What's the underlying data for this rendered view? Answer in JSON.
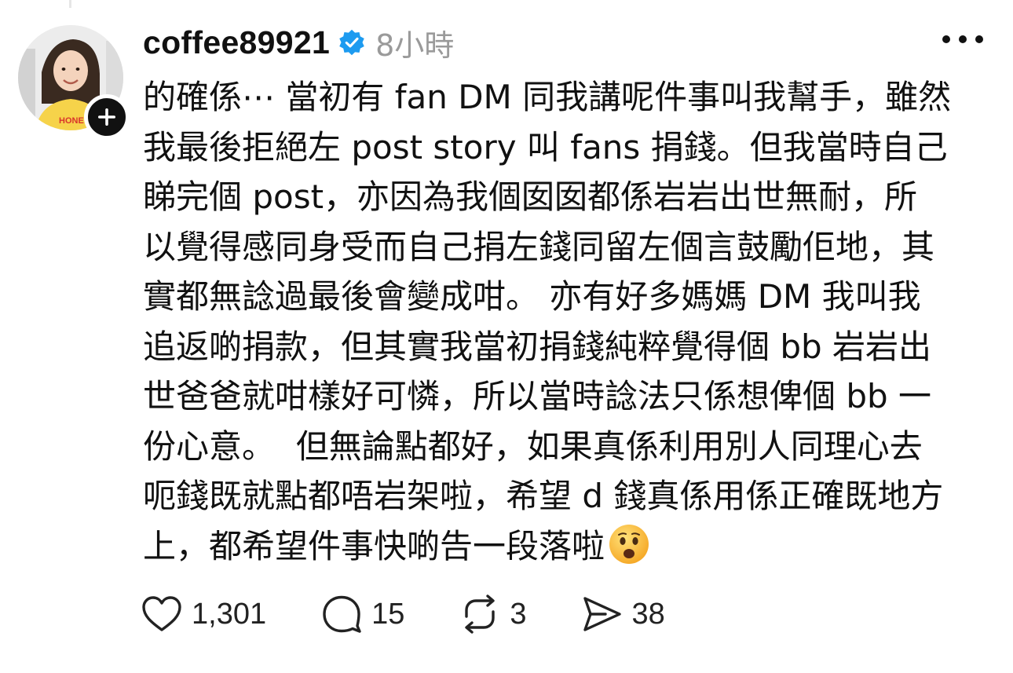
{
  "post": {
    "username": "coffee89921",
    "verified": true,
    "timestamp": "8小時",
    "text": "的確係⋯ 當初有 fan DM 同我講呢件事叫我幫手，雖然\n我最後拒絕左 post story 叫 fans 捐錢。但我當時自己\n睇完個 post，亦因為我個囡囡都係岩岩出世無耐，所\n以覺得感同身受而自己捐左錢同留左個言鼓勵佢地，其\n實都無諗過最後會變成咁。 亦有好多媽媽 DM 我叫我\n追返啲捐款，但其實我當初捐錢純粹覺得個 bb 岩岩出\n世爸爸就咁樣好可憐，所以當時諗法只係想俾個 bb 一\n份心意。  但無論點都好，如果真係利用別人同理心去\n呃錢既就點都唔岩架啦，希望 d 錢真係用係正確既地方\n上，都希望件事快啲告一段落啦",
    "emoji": "😦"
  },
  "actions": {
    "likes": "1,301",
    "comments": "15",
    "reposts": "3",
    "shares": "38"
  },
  "icons": {
    "verified": "verified-badge-icon",
    "more": "more-options-icon",
    "follow": "plus-icon",
    "like": "heart-icon",
    "comment": "comment-bubble-icon",
    "repost": "repost-icon",
    "share": "send-icon"
  },
  "colors": {
    "verified": "#1d9bf0",
    "text": "#111111",
    "muted": "#9a9a9a",
    "emoji_face": "#ffc83d"
  }
}
